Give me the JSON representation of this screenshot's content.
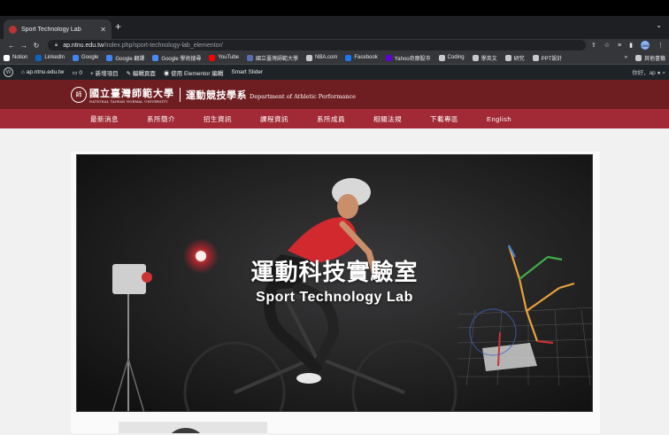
{
  "browser": {
    "tab_title": "Sport Technology Lab",
    "tab_close": "✕",
    "new_tab": "+",
    "tab_menu": "⌄",
    "url_host": "ap.ntnu.edu.tw",
    "url_path": "/index.php/sport-technology-lab_elementor/",
    "profile": "0596"
  },
  "bookmarks": [
    {
      "label": "Notion",
      "color": "#ffffff"
    },
    {
      "label": "LinkedIn",
      "color": "#0a66c2"
    },
    {
      "label": "Google",
      "color": "#4285f4"
    },
    {
      "label": "Google 翻譯",
      "color": "#4285f4"
    },
    {
      "label": "Google 學術搜尋",
      "color": "#4a8af4"
    },
    {
      "label": "YouTube",
      "color": "#ff0000"
    },
    {
      "label": "國立臺灣師範大學",
      "color": "#5a6bb0"
    },
    {
      "label": "NBA.com",
      "color": "#c9c9c9"
    },
    {
      "label": "Facebook",
      "color": "#1877f2"
    },
    {
      "label": "Yahoo奇摩股市",
      "color": "#6001d2"
    },
    {
      "label": "Coding",
      "color": "#c9c9c9"
    },
    {
      "label": "學英文",
      "color": "#c9c9c9"
    },
    {
      "label": "研究",
      "color": "#c9c9c9"
    },
    {
      "label": "PPT設計",
      "color": "#c9c9c9"
    }
  ],
  "bookmarks_more": "»",
  "bookmarks_other": "其他書籤",
  "wpbar": {
    "site": "ap.ntnu.edu.tw",
    "comments": "0",
    "new": "新增項目",
    "edit": "編輯頁面",
    "elementor": "使用 Elementor 編輯",
    "slider": "Smart Slider",
    "greeting": "你好，ap"
  },
  "site": {
    "university_zh": "國立臺灣師範大學",
    "university_en": "NATIONAL TAIWAN NORMAL UNIVERSITY",
    "dept_zh": "運動競技學系",
    "dept_en": "Department of Athletic Performance"
  },
  "nav": [
    "最新消息",
    "系所簡介",
    "招生資訊",
    "課程資訊",
    "系所成員",
    "相關法規",
    "下載專區",
    "English"
  ],
  "hero": {
    "title": "運動科技實驗室",
    "subtitle": "Sport Technology Lab"
  }
}
